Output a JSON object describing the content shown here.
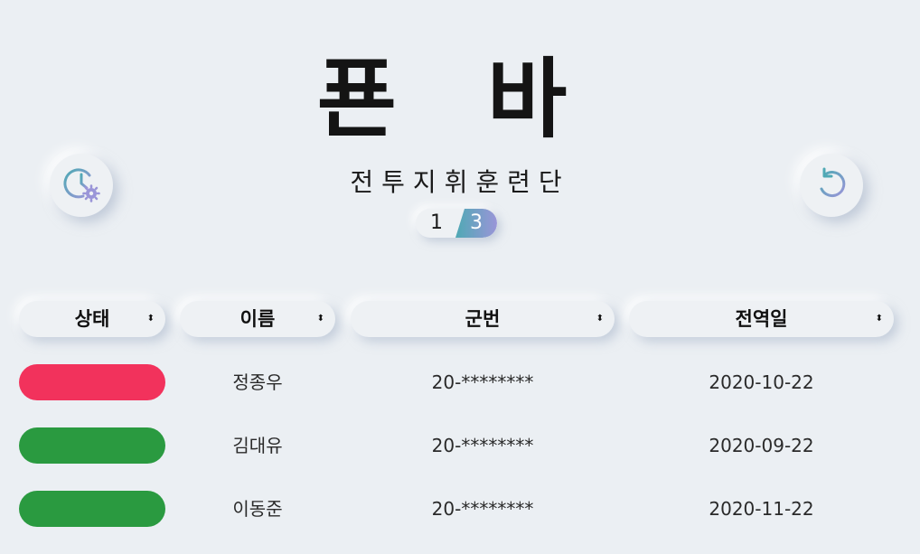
{
  "header": {
    "title_part1": "푠",
    "title_part2": "바",
    "subtitle": "전투지휘훈련단",
    "toggle": {
      "left_value": "1",
      "right_value": "3"
    }
  },
  "icons": {
    "schedule": "clock-settings-icon",
    "refresh": "refresh-icon"
  },
  "colors": {
    "background": "#ebeff3",
    "status_red": "#f2325c",
    "status_green": "#2a9a40",
    "accent_start": "#4fa9b4",
    "accent_end": "#9a95d8"
  },
  "table": {
    "columns": [
      {
        "label": "상태",
        "sort_icon": "sort-icon"
      },
      {
        "label": "이름",
        "sort_icon": "sort-icon"
      },
      {
        "label": "군번",
        "sort_icon": "sort-icon"
      },
      {
        "label": "전역일",
        "sort_icon": "sort-icon"
      }
    ],
    "sort_glyph": "⬍",
    "rows": [
      {
        "status": "red",
        "name": "정종우",
        "id": "20-********",
        "date": "2020-10-22"
      },
      {
        "status": "green",
        "name": "김대유",
        "id": "20-********",
        "date": "2020-09-22"
      },
      {
        "status": "green",
        "name": "이동준",
        "id": "20-********",
        "date": "2020-11-22"
      }
    ]
  }
}
